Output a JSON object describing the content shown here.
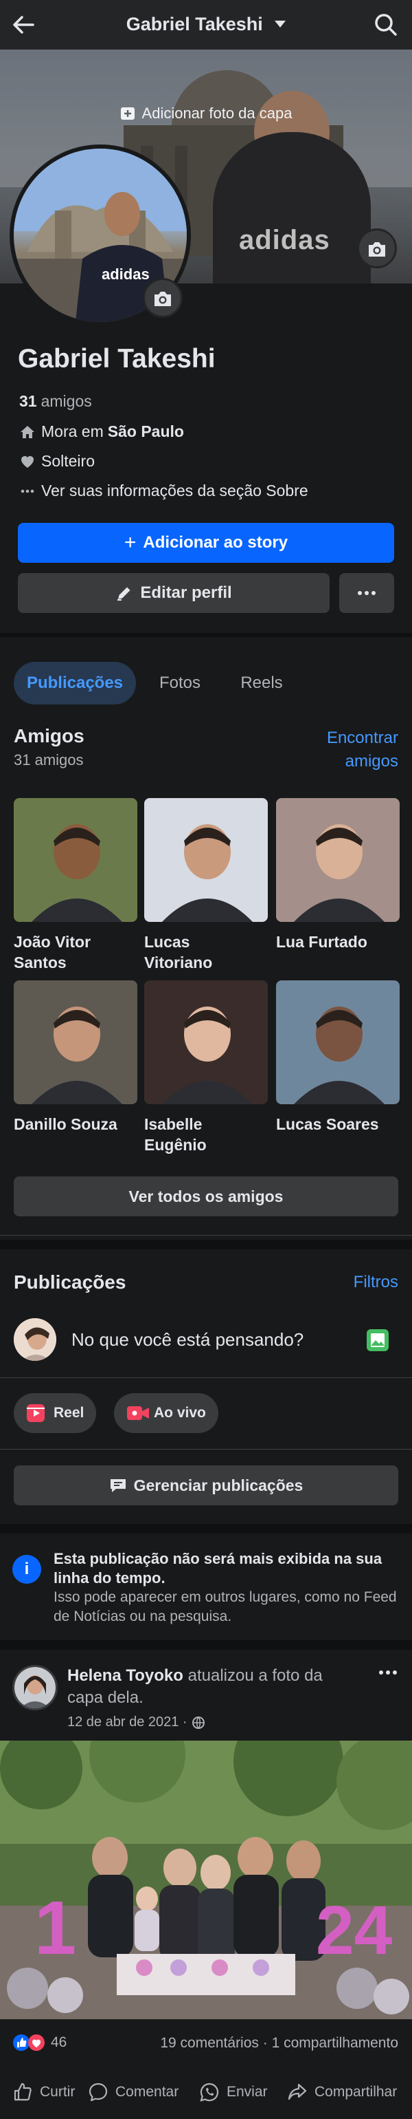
{
  "header": {
    "title": "Gabriel Takeshi"
  },
  "cover": {
    "add_cover_label": "Adicionar foto da capa",
    "shirt_text": "adidas"
  },
  "profile": {
    "name": "Gabriel Takeshi",
    "friends_count": "31",
    "friends_label": "amigos",
    "lives_prefix": "Mora em",
    "city": "São Paulo",
    "relationship": "Solteiro",
    "about_link": "Ver suas informações da seção Sobre",
    "add_story_label": "Adicionar ao story",
    "edit_profile_label": "Editar perfil"
  },
  "tabs": [
    {
      "label": "Publicações",
      "active": true
    },
    {
      "label": "Fotos",
      "active": false
    },
    {
      "label": "Reels",
      "active": false
    }
  ],
  "friends": {
    "title": "Amigos",
    "count_label": "31 amigos",
    "find_label_1": "Encontrar",
    "find_label_2": "amigos",
    "items": [
      {
        "name_1": "João Vitor",
        "name_2": "Santos",
        "bg": "#6b7a4a",
        "skin": "#8a5c3e"
      },
      {
        "name_1": "Lucas",
        "name_2": "Vitoriano",
        "bg": "#d7dbe3",
        "skin": "#c99a7c"
      },
      {
        "name_1": "Lua Furtado",
        "name_2": "",
        "bg": "#a48f8a",
        "skin": "#d9b196"
      },
      {
        "name_1": "Danillo Souza",
        "name_2": "",
        "bg": "#5e5a52",
        "skin": "#c5967a"
      },
      {
        "name_1": "Isabelle",
        "name_2": "Eugênio",
        "bg": "#3a2c2a",
        "skin": "#e0b8a0"
      },
      {
        "name_1": "Lucas Soares",
        "name_2": "",
        "bg": "#6f879c",
        "skin": "#7a5440"
      }
    ],
    "see_all_label": "Ver todos os amigos"
  },
  "posts_section": {
    "title": "Publicações",
    "filters_label": "Filtros",
    "composer_placeholder": "No que você está pensando?",
    "reel_label": "Reel",
    "live_label": "Ao vivo",
    "manage_label": "Gerenciar publicações"
  },
  "notice": {
    "title": "Esta publicação não será mais exibida na sua linha do tempo.",
    "body": "Isso pode aparecer em outros lugares, como no Feed de Notícias ou na pesquisa."
  },
  "post": {
    "author": "Helena Toyoko",
    "action_1": "atualizou a foto da",
    "action_2": "capa dela.",
    "date": "12 de abr de 2021 ·",
    "reactions_count": "46",
    "comments_shares": "19 comentários · 1 compartilhamento",
    "like_label": "Curtir",
    "comment_label": "Comentar",
    "send_label": "Enviar",
    "share_label": "Compartilhar"
  },
  "colors": {
    "accent": "#0866ff",
    "link": "#4599ff",
    "bg": "#18191a",
    "surface": "#242526",
    "button": "#3a3b3c"
  }
}
